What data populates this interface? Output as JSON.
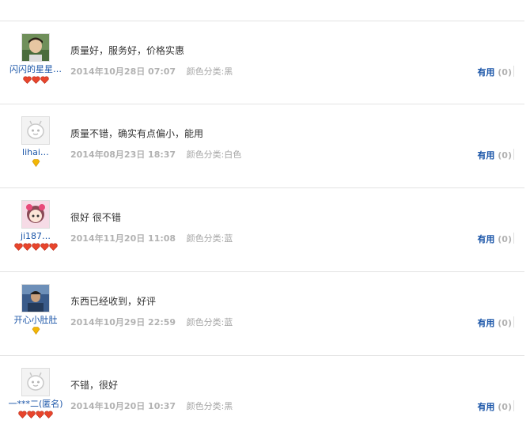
{
  "colors": {
    "link": "#1a55a8",
    "meta": "#a5a5a5",
    "divider": "#e3e3e3",
    "badge_red": "#e8452c",
    "badge_yellow": "#f2b705"
  },
  "useful_label": "有用",
  "reviews": [
    {
      "username": "闪闪的星星…",
      "avatar": "photo-avatar-boy",
      "badge_type": "heart",
      "badge_count": 3,
      "content": "质量好，服务好，价格实惠",
      "date": "2014年10月28日 07:07",
      "spec": "颜色分类:黑",
      "useful_count": "(0)"
    },
    {
      "username": "lihai…",
      "avatar": "default-avatar",
      "badge_type": "diamond",
      "badge_count": 1,
      "content": "质量不错，确实有点偏小，能用",
      "date": "2014年08月23日 18:37",
      "spec": "颜色分类:白色",
      "useful_count": "(0)"
    },
    {
      "username": "ji187…",
      "avatar": "cartoon-avatar-girl",
      "badge_type": "heart",
      "badge_count": 5,
      "content": "很好 很不错",
      "date": "2014年11月20日 11:08",
      "spec": "颜色分类:蓝",
      "useful_count": "(0)"
    },
    {
      "username": "开心小肚肚",
      "avatar": "photo-avatar-man",
      "badge_type": "diamond",
      "badge_count": 1,
      "content": "东西已经收到，好评",
      "date": "2014年10月29日 22:59",
      "spec": "颜色分类:蓝",
      "useful_count": "(0)"
    },
    {
      "username": "一***二(匿名)",
      "avatar": "default-avatar",
      "badge_type": "heart",
      "badge_count": 4,
      "content": "不错，很好",
      "date": "2014年10月20日 10:37",
      "spec": "颜色分类:黑",
      "useful_count": "(0)"
    }
  ]
}
